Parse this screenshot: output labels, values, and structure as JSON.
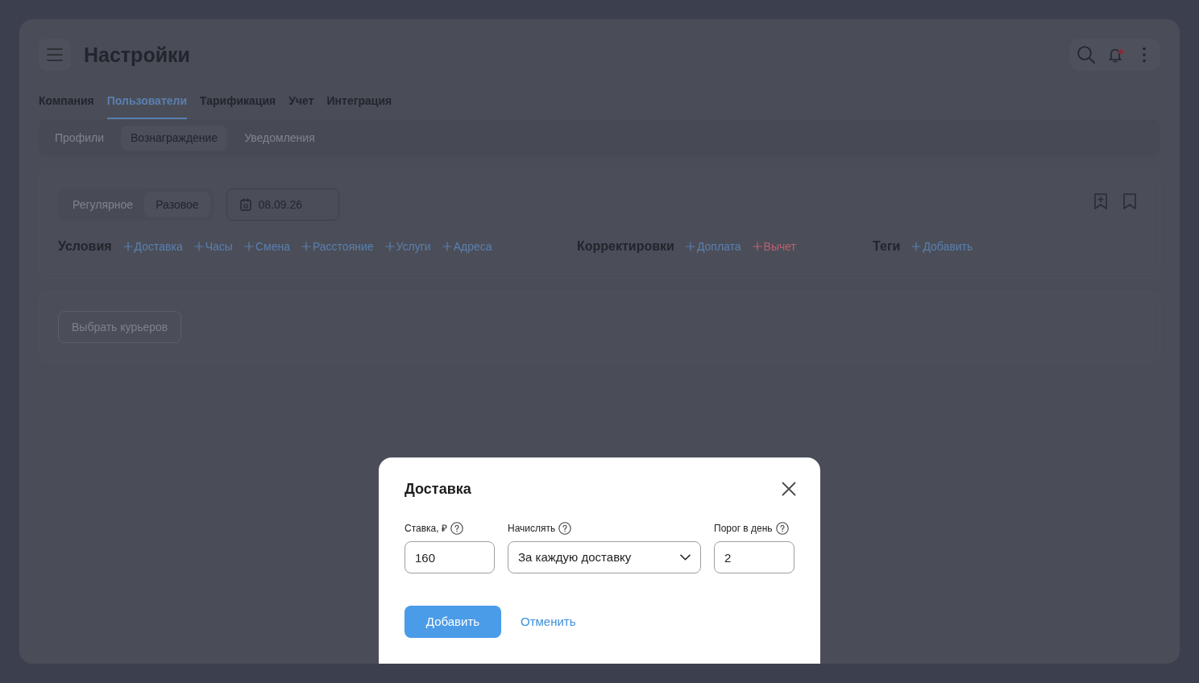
{
  "header": {
    "title": "Настройки",
    "unread_notifications": true
  },
  "tabs": [
    {
      "label": "Компания",
      "selected": false
    },
    {
      "label": "Пользователи",
      "selected": true
    },
    {
      "label": "Тарификация",
      "selected": false
    },
    {
      "label": "Учет",
      "selected": false
    },
    {
      "label": "Интеграция",
      "selected": false
    }
  ],
  "subtabs": [
    {
      "label": "Профили",
      "selected": false
    },
    {
      "label": "Вознаграждение",
      "selected": true
    },
    {
      "label": "Уведомления",
      "selected": false
    }
  ],
  "reward_card": {
    "schedule_toggle": [
      {
        "label": "Регулярное",
        "selected": false
      },
      {
        "label": "Разовое",
        "selected": true
      }
    ],
    "date": "08.09.26",
    "groups": [
      {
        "title": "Условия",
        "actions": [
          {
            "label": "Доставка"
          },
          {
            "label": "Часы"
          },
          {
            "label": "Смена"
          },
          {
            "label": "Расстояние"
          },
          {
            "label": "Услуги"
          },
          {
            "label": "Адреса"
          }
        ]
      },
      {
        "title": "Корректировки",
        "actions": [
          {
            "label": "Доплата",
            "color": "#5a7fb0"
          },
          {
            "label": "Вычет",
            "color": "#bc6070"
          }
        ]
      },
      {
        "title": "Теги",
        "actions": [
          {
            "label": "Добавить"
          }
        ]
      }
    ]
  },
  "couriers_card": {
    "button": {
      "label": "Выбрать курьеров",
      "disabled": true
    }
  },
  "modal": {
    "title": "Доставка",
    "fields": [
      {
        "label": "Ставка, ₽",
        "kind": "input",
        "value": "160"
      },
      {
        "label": "Начислять",
        "kind": "select",
        "value": "За каждую доставку"
      },
      {
        "label": "Порог в день",
        "kind": "input",
        "value": "2"
      }
    ],
    "buttons": [
      {
        "label": "Добавить",
        "kind": "primary"
      },
      {
        "label": "Отменить",
        "kind": "link"
      }
    ]
  }
}
